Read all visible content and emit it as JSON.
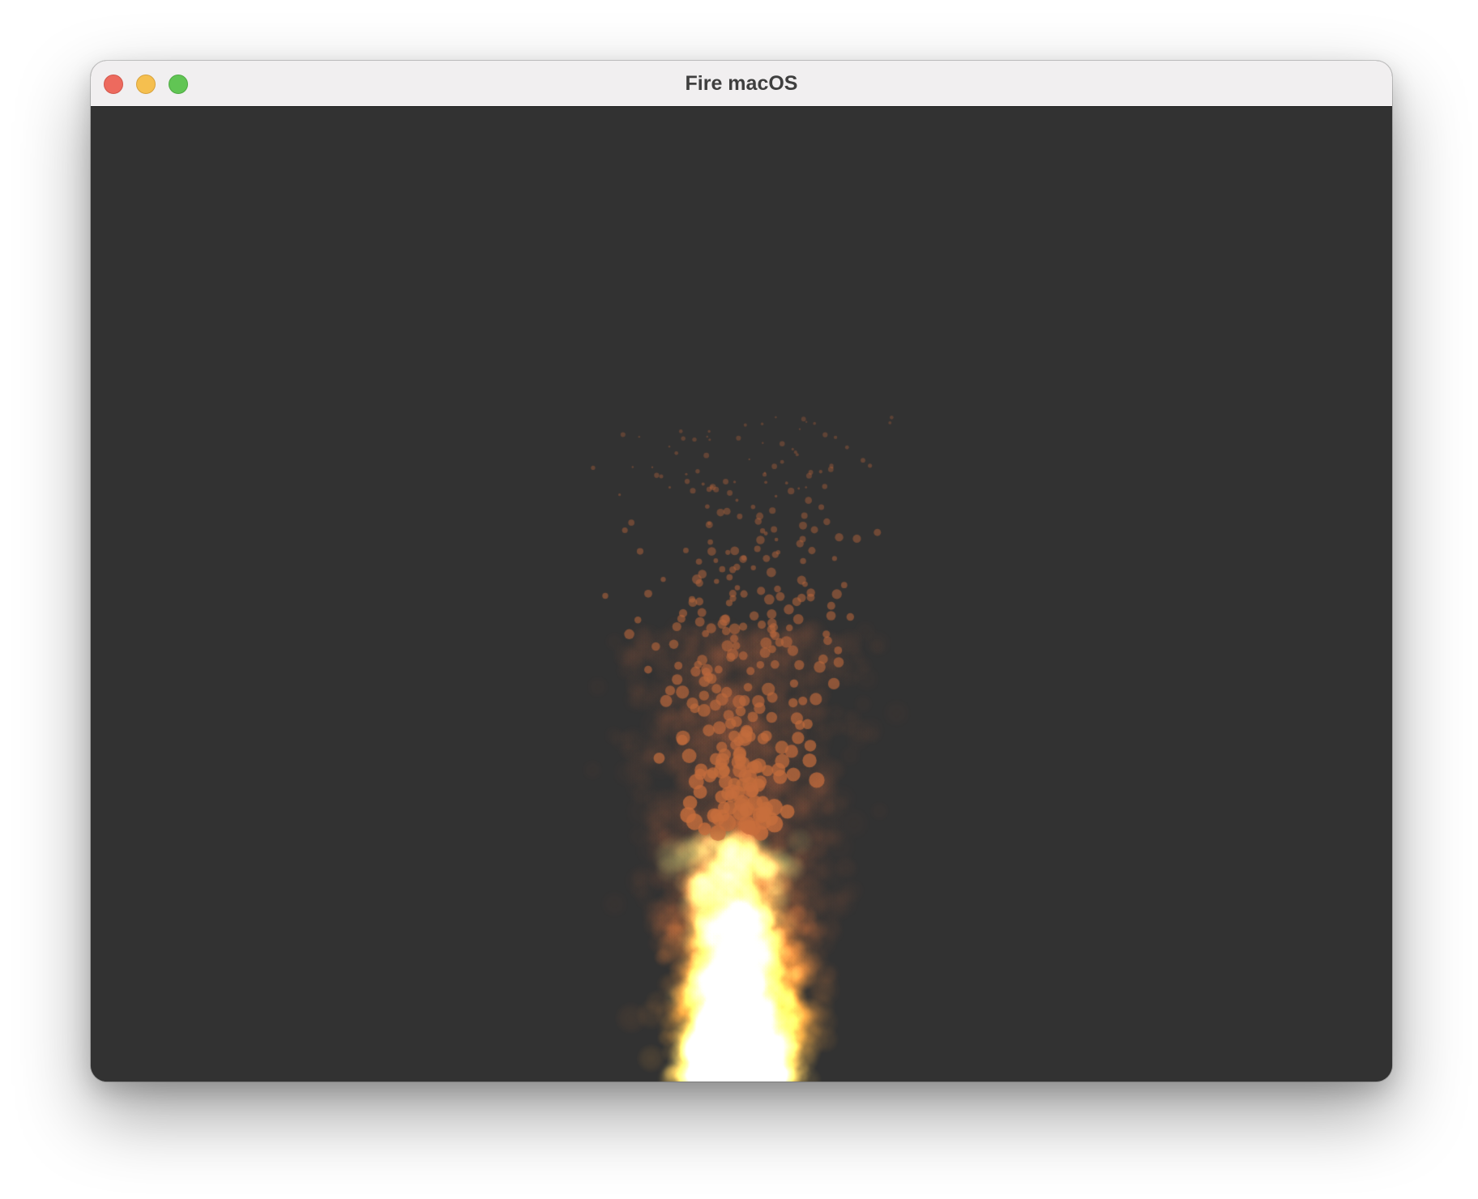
{
  "window": {
    "title": "Fire macOS",
    "buttons": [
      {
        "name": "close",
        "color": "#ed6a5e",
        "border": "#d2564b"
      },
      {
        "name": "minimize",
        "color": "#f5bf4f",
        "border": "#d7a23c"
      },
      {
        "name": "zoom",
        "color": "#61c554",
        "border": "#4fa943"
      }
    ]
  },
  "scene": {
    "background": "#323232",
    "effect": "particle-fire",
    "colors": {
      "core": "#fff98a",
      "mid": "#ffb348",
      "ember": "#c9703e",
      "smoke": "#a05a3c"
    }
  }
}
